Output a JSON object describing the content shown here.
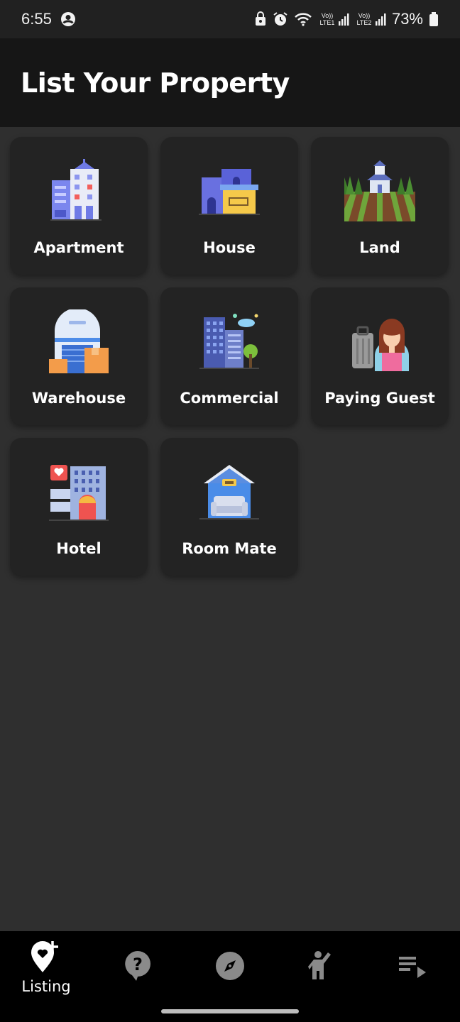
{
  "status_bar": {
    "time": "6:55",
    "battery": "73%",
    "sim1": "Vo)) LTE1",
    "sim2": "Vo)) LTE2",
    "icons": [
      "account-circle-icon",
      "lock-icon",
      "alarm-icon",
      "wifi-icon",
      "signal-icon",
      "battery-icon"
    ]
  },
  "header": {
    "title": "List Your Property"
  },
  "property_types": [
    {
      "label": "Apartment",
      "icon": "apartment-icon"
    },
    {
      "label": "House",
      "icon": "house-icon"
    },
    {
      "label": "Land",
      "icon": "land-icon"
    },
    {
      "label": "Warehouse",
      "icon": "warehouse-icon"
    },
    {
      "label": "Commercial",
      "icon": "commercial-icon"
    },
    {
      "label": "Paying Guest",
      "icon": "paying-guest-icon"
    },
    {
      "label": "Hotel",
      "icon": "hotel-icon"
    },
    {
      "label": "Room Mate",
      "icon": "room-mate-icon"
    }
  ],
  "bottom_nav": {
    "items": [
      {
        "label": "Listing",
        "icon": "add-location-icon",
        "active": true
      },
      {
        "label": "",
        "icon": "help-icon",
        "active": false
      },
      {
        "label": "",
        "icon": "compass-icon",
        "active": false
      },
      {
        "label": "",
        "icon": "person-waving-icon",
        "active": false
      },
      {
        "label": "",
        "icon": "playlist-play-icon",
        "active": false
      }
    ]
  },
  "colors": {
    "background": "#2f2f2f",
    "header_bg": "#161616",
    "card_bg": "#232323",
    "nav_bg": "#000000",
    "text": "#ffffff",
    "inactive_icon": "#8a8a8a"
  }
}
